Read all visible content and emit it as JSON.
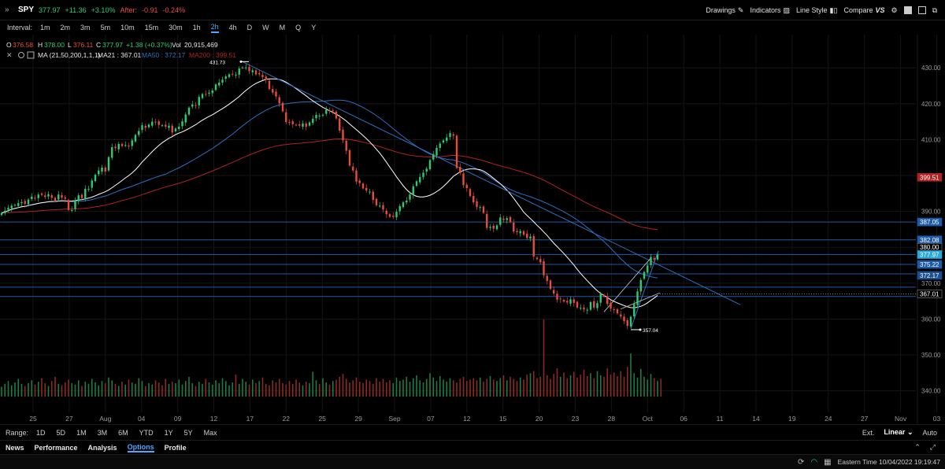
{
  "header": {
    "symbol": "SPY",
    "last": "377.97",
    "change": "+11.36",
    "change_pct": "+3.10%",
    "after_label": "After:",
    "after_change": "-0.91",
    "after_pct": "-0.24%",
    "buttons": {
      "drawings": "Drawings",
      "indicators": "Indicators",
      "line_style": "Line Style",
      "compare": "Compare"
    }
  },
  "intervals": {
    "label": "Interval:",
    "items": [
      "1m",
      "2m",
      "3m",
      "5m",
      "10m",
      "15m",
      "30m",
      "1h",
      "2h",
      "4h",
      "D",
      "W",
      "M",
      "Q",
      "Y"
    ],
    "active": "2h"
  },
  "ohlc": {
    "o_label": "O",
    "o": "376.58",
    "h_label": "H",
    "h": "378.00",
    "l_label": "L",
    "l": "376.11",
    "c_label": "C",
    "c": "377.97",
    "chg": "+1.38 (+0.37%)",
    "vol_label": "Vol",
    "vol": "20,915,469"
  },
  "ma_legend": {
    "title": "MA (21,50,200,1,1,1)",
    "ma21": "MA21 : 367.01",
    "ma50": "MA50 : 372.17",
    "ma200": "MA200 : 399.51"
  },
  "chart_data": {
    "type": "candlestick",
    "title": "SPY 2h",
    "ylim": [
      334,
      434
    ],
    "y_ticks": [
      "430.00",
      "420.00",
      "410.00",
      "400.00",
      "390.00",
      "380.00",
      "370.00",
      "360.00",
      "350.00",
      "340.00"
    ],
    "x_ticks": [
      "25",
      "27",
      "Aug",
      "04",
      "09",
      "12",
      "17",
      "22",
      "25",
      "29",
      "Sep",
      "07",
      "12",
      "15",
      "20",
      "23",
      "28",
      "Oct",
      "06",
      "11",
      "14",
      "19",
      "24",
      "27",
      "Nov",
      "03"
    ],
    "annotations": {
      "high": "431.73",
      "low": "357.04"
    },
    "price_labels": [
      {
        "text": "399.51",
        "value": 399.51,
        "color": "#b22222"
      },
      {
        "text": "387.05",
        "value": 387.05,
        "color": "#1e5aa8"
      },
      {
        "text": "382.08",
        "value": 382.08,
        "color": "#1e5aa8"
      },
      {
        "text": "380.00",
        "value": 380.0,
        "color": "#000000"
      },
      {
        "text": "377.97",
        "value": 377.97,
        "color": "#29a9d8"
      },
      {
        "text": "375.22",
        "value": 375.22,
        "color": "#1e5aa8"
      },
      {
        "text": "372.17",
        "value": 372.17,
        "color": "#1b4f8f"
      },
      {
        "text": "367.01",
        "value": 367.01,
        "color": "#000000"
      }
    ],
    "horizontal_lines": [
      387.05,
      382.08,
      378.0,
      375.22,
      372.6,
      368.9,
      366.3
    ],
    "colors": {
      "up": "#2ecc71",
      "down": "#e74c3c",
      "ma21": "#ffffff",
      "ma50": "#2f6fbf",
      "ma200": "#b22222",
      "hline": "#1e5aa8"
    },
    "closes": [
      389.5,
      390.2,
      391.0,
      391.6,
      391.8,
      392.3,
      392.6,
      392.1,
      393.3,
      394.1,
      393.7,
      394.7,
      394.6,
      394.0,
      394.8,
      393.8,
      393.0,
      394.7,
      393.8,
      393.5,
      390.4,
      390.4,
      393.1,
      394.5,
      393.7,
      396.3,
      396.3,
      398.6,
      400.2,
      401.4,
      402.2,
      401.1,
      405.1,
      407.9,
      407.6,
      408.8,
      408.2,
      408.5,
      408.1,
      409.8,
      411.3,
      412.4,
      414.0,
      413.3,
      414.2,
      415.0,
      414.8,
      414.1,
      414.0,
      413.6,
      413.9,
      412.0,
      413.1,
      413.6,
      415.1,
      417.0,
      418.9,
      419.8,
      419.4,
      421.9,
      422.7,
      422.5,
      423.1,
      423.7,
      425.4,
      425.9,
      426.7,
      427.6,
      428.2,
      428.2,
      428.1,
      429.8,
      430.1,
      430.1,
      429.1,
      429.3,
      428.2,
      428.2,
      427.4,
      426.7,
      424.1,
      423.1,
      422.0,
      420.1,
      417.9,
      414.9,
      414.8,
      414.3,
      414.1,
      413.9,
      414.5,
      413.6,
      414.8,
      415.8,
      416.9,
      416.7,
      416.9,
      418.3,
      418.0,
      418.1,
      415.9,
      412.5,
      409.8,
      406.9,
      402.8,
      401.4,
      398.3,
      397.9,
      396.4,
      395.8,
      395.5,
      393.2,
      391.7,
      391.6,
      390.5,
      389.2,
      388.5,
      388.5,
      389.9,
      391.5,
      392.5,
      393.0,
      394.7,
      397.0,
      398.4,
      399.6,
      400.8,
      401.9,
      404.3,
      405.9,
      407.7,
      408.9,
      409.8,
      410.6,
      411.8,
      411.1,
      402.1,
      400.7,
      397.3,
      396.5,
      394.3,
      392.5,
      391.2,
      391.2,
      389.6,
      385.4,
      385.7,
      385.2,
      386.1,
      388.3,
      387.6,
      388.1,
      387.0,
      384.4,
      384.2,
      384.5,
      383.5,
      382.6,
      383.0,
      377.4,
      376.7,
      375.8,
      372.2,
      370.6,
      368.4,
      367.1,
      365.4,
      365.5,
      364.9,
      364.6,
      365.5,
      364.5,
      363.2,
      363.1,
      362.7,
      362.6,
      364.7,
      363.2,
      364.4,
      367.0,
      366.3,
      364.2,
      362.9,
      362.6,
      361.6,
      360.7,
      359.4,
      358.1,
      360.6,
      364.2,
      367.7,
      370.9,
      373.1,
      374.9,
      377.3,
      376.6,
      377.97
    ],
    "volumes": [
      14,
      18,
      22,
      16,
      20,
      25,
      18,
      15,
      19,
      23,
      17,
      21,
      26,
      19,
      15,
      22,
      28,
      18,
      16,
      20,
      24,
      19,
      17,
      23,
      15,
      21,
      18,
      25,
      20,
      16,
      22,
      19,
      27,
      23,
      18,
      15,
      21,
      17,
      24,
      20,
      18,
      26,
      22,
      15,
      19,
      17,
      23,
      20,
      16,
      25,
      18,
      21,
      19,
      24,
      17,
      22,
      28,
      19,
      15,
      21,
      18,
      25,
      20,
      17,
      23,
      19,
      26,
      22,
      16,
      20,
      31,
      18,
      25,
      21,
      17,
      24,
      19,
      22,
      27,
      18,
      16,
      23,
      20,
      25,
      19,
      17,
      22,
      18,
      24,
      20,
      16,
      21,
      19,
      35,
      23,
      18,
      26,
      20,
      17,
      22,
      24,
      28,
      32,
      25,
      20,
      23,
      27,
      21,
      19,
      24,
      22,
      18,
      26,
      21,
      25,
      20,
      23,
      19,
      27,
      22,
      24,
      28,
      21,
      26,
      30,
      23,
      20,
      25,
      33,
      27,
      22,
      29,
      24,
      21,
      26,
      23,
      20,
      25,
      28,
      22,
      24,
      26,
      23,
      27,
      21,
      25,
      29,
      24,
      22,
      26,
      30,
      23,
      28,
      25,
      22,
      27,
      24,
      31,
      33,
      36,
      26,
      28,
      55,
      30,
      25,
      32,
      40,
      28,
      34,
      26,
      30,
      35,
      27,
      31,
      38,
      29,
      33,
      26,
      36,
      30,
      28,
      40,
      31,
      34,
      29,
      36,
      28,
      42,
      30,
      33,
      27,
      39,
      28,
      24,
      32,
      26,
      22,
      25
    ],
    "volume_spikes": [
      {
        "i": 162,
        "v": 68
      },
      {
        "i": 188,
        "v": 38
      }
    ],
    "ma21": [],
    "ma50": [],
    "ma200": []
  },
  "range": {
    "label": "Range:",
    "items": [
      "1D",
      "5D",
      "1M",
      "3M",
      "6M",
      "YTD",
      "1Y",
      "5Y",
      "Max"
    ],
    "ext": "Ext.",
    "scale": "Linear",
    "auto": "Auto"
  },
  "bottom_tabs": {
    "items": [
      "News",
      "Performance",
      "Analysis",
      "Options",
      "Profile"
    ],
    "active": "Options"
  },
  "status": {
    "timezone": "Eastern Time 10/04/2022 19:19:47"
  }
}
